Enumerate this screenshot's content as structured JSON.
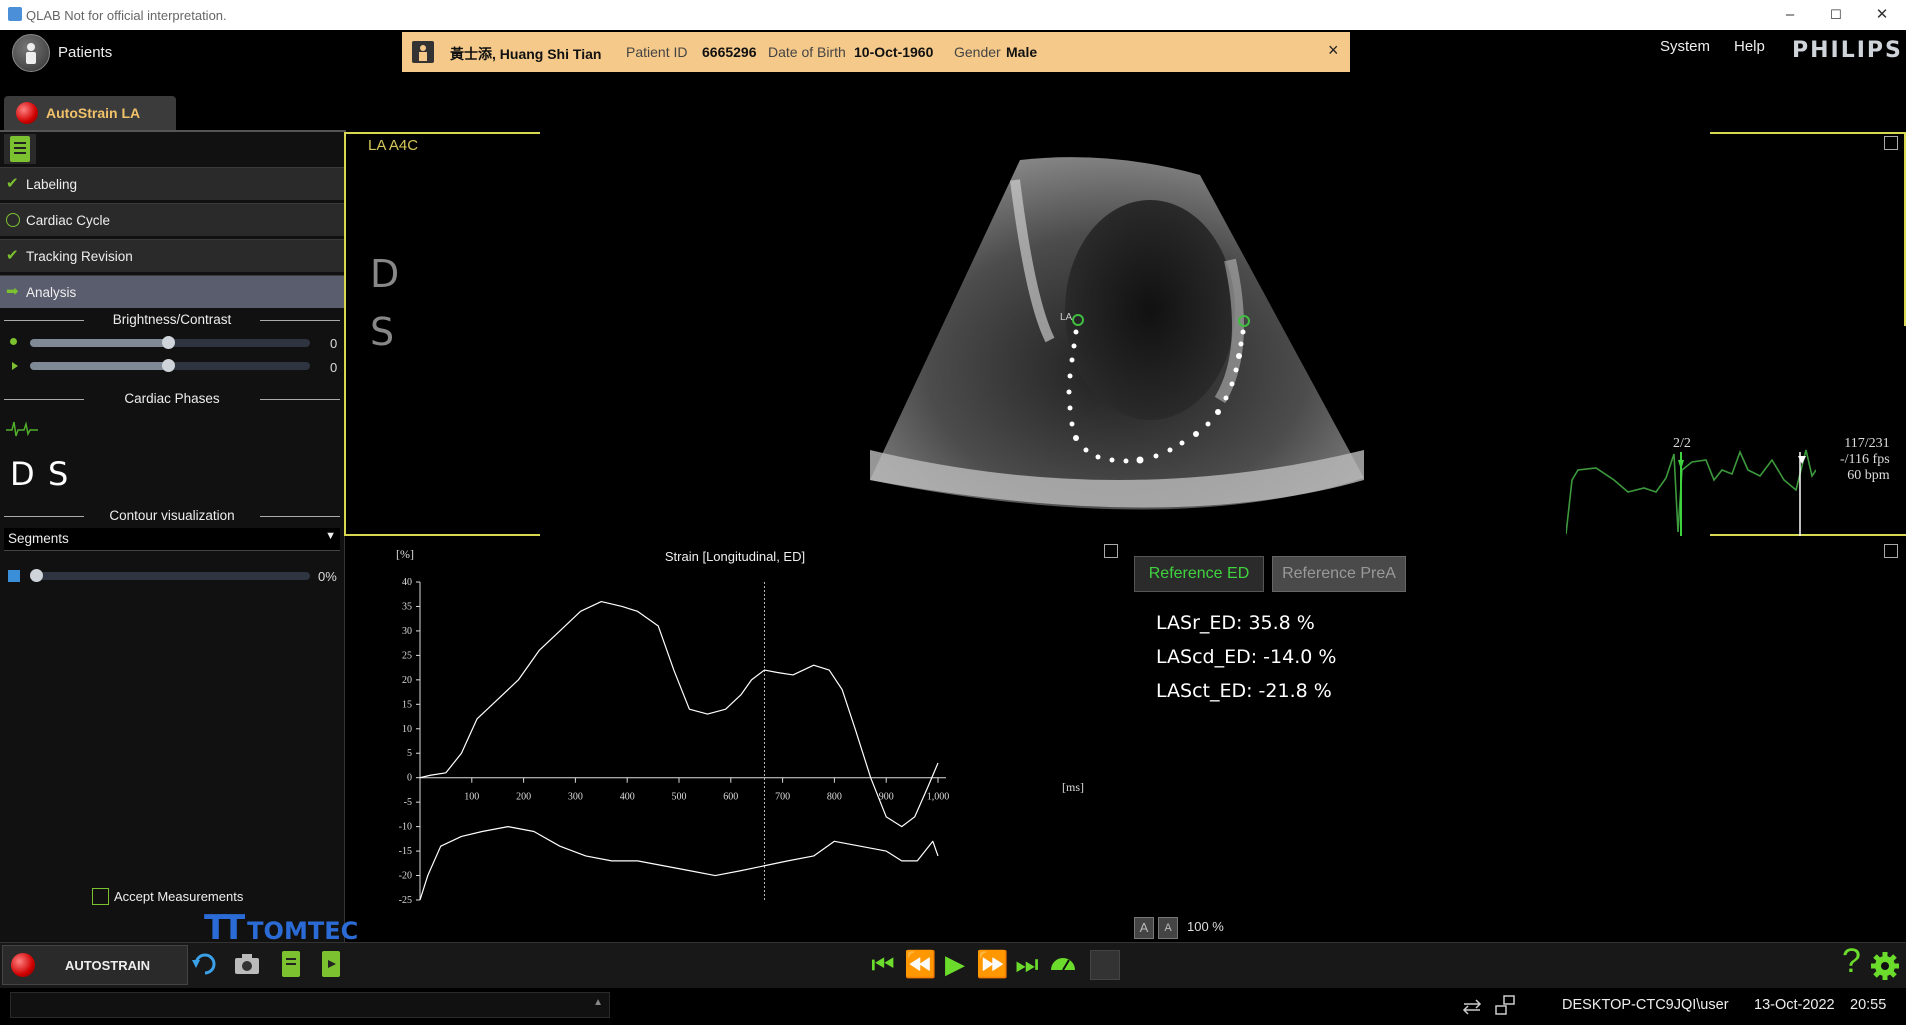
{
  "window": {
    "title": "QLAB Not for official interpretation.",
    "minimize": "–",
    "maximize": "☐",
    "close": "✕"
  },
  "topbar": {
    "patients_label": "Patients",
    "system_label": "System",
    "help_label": "Help",
    "brand": "PHILIPS"
  },
  "patient": {
    "name": "黃士添, Huang Shi Tian",
    "id_label": "Patient ID",
    "id_value": "6665296",
    "dob_label": "Date of Birth",
    "dob_value": "10-Oct-1960",
    "gender_label": "Gender",
    "gender_value": "Male",
    "close": "×"
  },
  "tab": {
    "label": "AutoStrain LA"
  },
  "workflow": {
    "steps": [
      {
        "label": "Labeling",
        "state": "done"
      },
      {
        "label": "Cardiac Cycle",
        "state": "open"
      },
      {
        "label": "Tracking Revision",
        "state": "done"
      },
      {
        "label": "Analysis",
        "state": "active"
      }
    ],
    "brightness_heading": "Brightness/Contrast",
    "brightness_value": "0",
    "contrast_value": "0",
    "phases_heading": "Cardiac Phases",
    "phase_d": "D",
    "phase_s": "S",
    "contour_heading": "Contour visualization",
    "contour_mode": "Segments",
    "opacity_value": "0%",
    "accept_label": "Accept Measurements",
    "logo": "TOMTEC",
    "logo_mark": "TT"
  },
  "viewport": {
    "label": "LA A4C",
    "overlay_d": "D",
    "overlay_s": "S",
    "marker_label": "LA",
    "frame_counter": "2/2",
    "frame_info": "117/231",
    "fps": "-/116 fps",
    "bpm": "60 bpm"
  },
  "chart_data": {
    "type": "line",
    "title": "Strain [Longitudinal, ED]",
    "ylabel": "[%]",
    "xlabel": "[ms]",
    "xlim": [
      0,
      1000
    ],
    "ylim": [
      -25,
      40
    ],
    "xticks": [
      100,
      200,
      300,
      400,
      500,
      600,
      700,
      800,
      900,
      1000
    ],
    "xtick_labels": [
      "100",
      "200",
      "300",
      "400",
      "500",
      "600",
      "700",
      "800",
      "900",
      "1,000"
    ],
    "yticks": [
      40,
      35,
      30,
      25,
      20,
      15,
      10,
      5,
      0,
      -5,
      -10,
      -15,
      -20,
      -25
    ],
    "cursor_x": 665,
    "series": [
      {
        "x": [
          0,
          20,
          50,
          80,
          110,
          150,
          190,
          230,
          270,
          310,
          350,
          390,
          420,
          460,
          490,
          520,
          555,
          590,
          620,
          640,
          665,
          690,
          720,
          760,
          790,
          815,
          840,
          870,
          900,
          930,
          955,
          980,
          1000
        ],
        "y": [
          0,
          0.5,
          1,
          5,
          12,
          16,
          20,
          26,
          30,
          34,
          36,
          35,
          34,
          31,
          22,
          14,
          13,
          14,
          17,
          20,
          22,
          21.5,
          21,
          23,
          22,
          18,
          10,
          0,
          -8,
          -10,
          -8,
          -2,
          3
        ]
      },
      {
        "x": [
          0,
          15,
          40,
          80,
          120,
          170,
          220,
          270,
          320,
          370,
          420,
          470,
          520,
          570,
          620,
          665,
          710,
          760,
          800,
          850,
          900,
          930,
          960,
          990,
          1000
        ],
        "y": [
          -25,
          -20,
          -14,
          -12,
          -11,
          -10,
          -11,
          -14,
          -16,
          -17,
          -17,
          -18,
          -19,
          -20,
          -19,
          -18,
          -17,
          -16,
          -13,
          -14,
          -15,
          -17,
          -17,
          -13,
          -16
        ]
      }
    ]
  },
  "results": {
    "ref_ed": "Reference ED",
    "ref_prea": "Reference PreA",
    "lines": [
      "LASr_ED: 35.8 %",
      "LAScd_ED: -14.0 %",
      "LASct_ED: -21.8 %"
    ],
    "zoom_a1": "A",
    "zoom_a2": "A",
    "zoom": "100 %"
  },
  "bottom": {
    "autostrain_label": "AUTOSTRAIN",
    "help_icon": "?",
    "status_arrow": "▲",
    "workstation": "DESKTOP-CTC9JQI\\user",
    "date": "13-Oct-2022",
    "time": "20:55"
  },
  "colors": {
    "accent": "#7cc130",
    "frame": "#d8d850",
    "banner": "#f5c98a",
    "ref_active": "#3fd33f"
  }
}
